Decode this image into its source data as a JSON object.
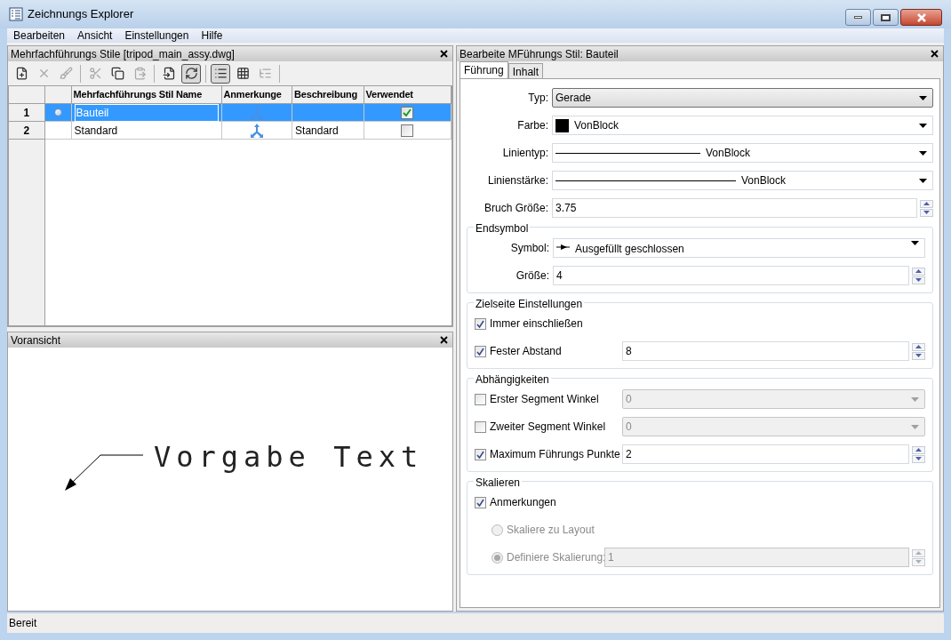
{
  "window": {
    "title": "Zeichnungs Explorer"
  },
  "menu": [
    "Bearbeiten",
    "Ansicht",
    "Einstellungen",
    "Hilfe"
  ],
  "styles_panel": {
    "title": "Mehrfachführungs Stile [tripod_main_assy.dwg]",
    "toolbar": [
      {
        "kind": "new",
        "disabled": false,
        "pressed": false
      },
      {
        "kind": "delete",
        "disabled": true,
        "pressed": false
      },
      {
        "kind": "purge",
        "disabled": true,
        "pressed": false
      },
      {
        "kind": "separator"
      },
      {
        "kind": "cut",
        "disabled": true,
        "pressed": false
      },
      {
        "kind": "copy",
        "disabled": false,
        "pressed": false
      },
      {
        "kind": "paste",
        "disabled": true,
        "pressed": false
      },
      {
        "kind": "separator"
      },
      {
        "kind": "import",
        "disabled": false,
        "pressed": false
      },
      {
        "kind": "refresh",
        "disabled": false,
        "pressed": true
      },
      {
        "kind": "separator"
      },
      {
        "kind": "list",
        "disabled": false,
        "pressed": true
      },
      {
        "kind": "icons",
        "disabled": false,
        "pressed": false
      },
      {
        "kind": "tree",
        "disabled": true,
        "pressed": false
      },
      {
        "kind": "separator"
      }
    ],
    "table": {
      "columns": [
        "Mehrfachführungs Stil Name",
        "Anmerkunge",
        "Beschreibung",
        "Verwendet"
      ],
      "rows": [
        {
          "number": "1",
          "selected": true,
          "current": true,
          "name": "Bauteil",
          "annotative": true,
          "used": true
        },
        {
          "number": "2",
          "selected": false,
          "current": false,
          "name": "Standard",
          "annotative": true,
          "description": "Standard",
          "used": false
        }
      ]
    }
  },
  "preview_panel": {
    "title": "Voransicht",
    "sample_text": "Vorgabe Text"
  },
  "editor": {
    "title": "Bearbeite MFührungs Stil: Bauteil",
    "tabs": [
      {
        "label": "Führung",
        "selected": true
      },
      {
        "label": "Inhalt",
        "selected": false
      }
    ],
    "fields": [
      {
        "label": "Typ:",
        "kind": "combo",
        "value": "Gerade"
      },
      {
        "label": "Farbe:",
        "kind": "color",
        "value": "VonBlock",
        "color": "#000000"
      },
      {
        "label": "Linientyp:",
        "kind": "linetype",
        "value": "VonBlock"
      },
      {
        "label": "Linienstärke:",
        "kind": "lineweight",
        "value": "VonBlock"
      },
      {
        "label": "Bruch Größe:",
        "kind": "spin",
        "value": "3.75"
      }
    ],
    "groups": [
      {
        "title": "Endsymbol",
        "rows": [
          {
            "kind": "field",
            "label": "Symbol:",
            "field": {
              "kind": "symbol",
              "value": "Ausgefüllt geschlossen"
            }
          },
          {
            "kind": "field",
            "label": "Größe:",
            "field": {
              "kind": "spin",
              "value": "4"
            }
          }
        ]
      },
      {
        "title": "Zielseite Einstellungen",
        "rows": [
          {
            "kind": "checkbox",
            "label": "Immer einschließen",
            "checked": true
          },
          {
            "kind": "checkbox",
            "label": "Fester Abstand",
            "checked": true,
            "field": {
              "kind": "spin",
              "value": "8"
            }
          }
        ]
      },
      {
        "title": "Abhängigkeiten",
        "rows": [
          {
            "kind": "checkbox",
            "label": "Erster Segment Winkel",
            "checked": false,
            "field": {
              "kind": "dropdown",
              "value": "0",
              "disabled": true
            }
          },
          {
            "kind": "checkbox",
            "label": "Zweiter Segment Winkel",
            "checked": false,
            "field": {
              "kind": "dropdown",
              "value": "0",
              "disabled": true
            }
          },
          {
            "kind": "checkbox",
            "label": "Maximum Führungs Punkte",
            "checked": true,
            "field": {
              "kind": "spin",
              "value": "2"
            }
          }
        ]
      },
      {
        "title": "Skalieren",
        "rows": [
          {
            "kind": "checkbox",
            "label": "Anmerkungen",
            "checked": true
          },
          {
            "kind": "radio",
            "label": "Skaliere zu Layout",
            "selected": false,
            "disabled": true
          },
          {
            "kind": "radio",
            "label": "Definiere Skalierung:",
            "selected": true,
            "disabled": true,
            "field": {
              "kind": "spin",
              "value": "1",
              "disabled": true
            }
          }
        ]
      }
    ]
  },
  "status_bar": "Bereit"
}
